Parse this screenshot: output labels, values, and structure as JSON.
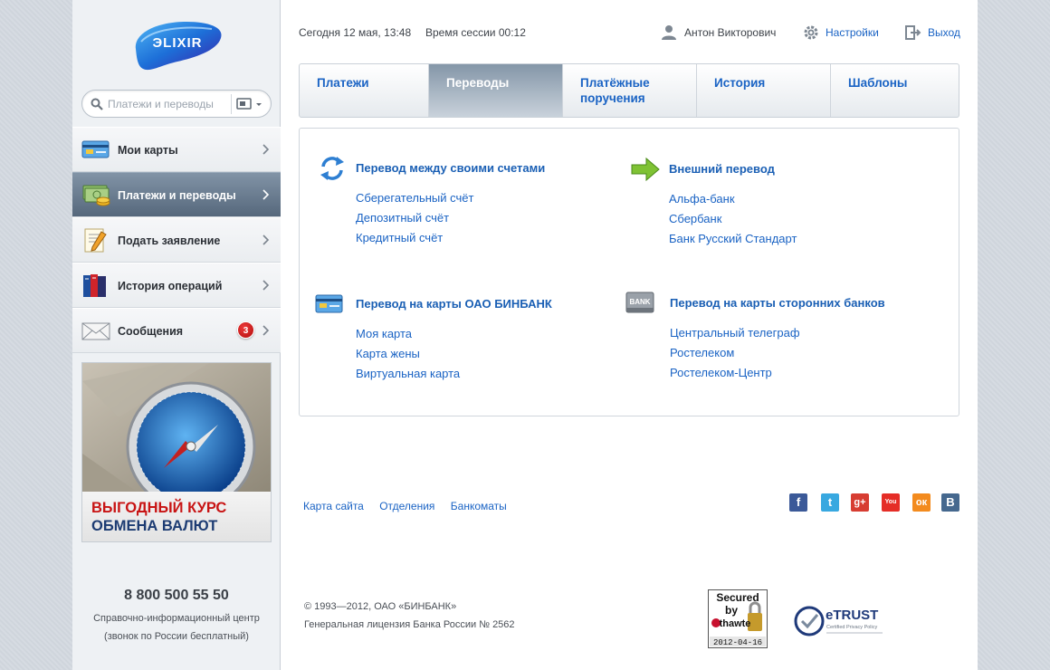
{
  "sidebar": {
    "logo_text": "ЭLIXIR",
    "search": {
      "placeholder": "Платежи и переводы"
    },
    "menu": [
      {
        "label": "Мои карты",
        "icon": "cards-icon",
        "active": false
      },
      {
        "label": "Платежи и переводы",
        "icon": "money-icon",
        "active": true
      },
      {
        "label": "Подать заявление",
        "icon": "application-icon",
        "active": false
      },
      {
        "label": "История операций",
        "icon": "books-icon",
        "active": false
      },
      {
        "label": "Сообщения",
        "icon": "envelope-icon",
        "active": false,
        "badge": "3"
      }
    ],
    "promo": {
      "line1": "ВЫГОДНЫЙ КУРС",
      "line2": "ОБМЕНА ВАЛЮТ"
    },
    "phone": "8 800 500 55 50",
    "phone_note_1": "Справочно-информационный центр",
    "phone_note_2": "(звонок по России бесплатный)"
  },
  "topbar": {
    "date": "Сегодня 12 мая, 13:48",
    "session": "Время сессии 00:12",
    "user": "Антон Викторович",
    "settings": "Настройки",
    "logout": "Выход"
  },
  "tabs": [
    {
      "label": "Платежи",
      "active": false
    },
    {
      "label": "Переводы",
      "active": true
    },
    {
      "label": "Платёжные поручения",
      "active": false
    },
    {
      "label": "История",
      "active": false
    },
    {
      "label": "Шаблоны",
      "active": false
    }
  ],
  "groups": {
    "own_accounts": {
      "title": "Перевод между своими счетами",
      "links": [
        "Сберегательный счёт",
        "Депозитный счёт",
        "Кредитный счёт"
      ]
    },
    "external": {
      "title": "Внешний перевод",
      "links": [
        "Альфа-банк",
        "Сбербанк",
        "Банк Русский Стандарт"
      ]
    },
    "binbank_cards": {
      "title": "Перевод на карты ОАО БИНБАНК",
      "links": [
        "Моя карта",
        "Карта жены",
        "Виртуальная карта"
      ]
    },
    "other_banks": {
      "title": "Перевод на карты сторонних банков",
      "icon_text": "BANK",
      "links": [
        "Центральный телеграф",
        "Ростелеком",
        "Ростелеком-Центр"
      ]
    }
  },
  "footer": {
    "links": [
      "Карта сайта",
      "Отделения",
      "Банкоматы"
    ],
    "socials": [
      {
        "name": "facebook-icon",
        "glyph": "f",
        "color": "#3b5998"
      },
      {
        "name": "twitter-icon",
        "glyph": "t",
        "color": "#38a8e0"
      },
      {
        "name": "google-plus-icon",
        "glyph": "g+",
        "color": "#d73d32"
      },
      {
        "name": "youtube-icon",
        "glyph": "You",
        "color": "#e52d27"
      },
      {
        "name": "odnoklassniki-icon",
        "glyph": "ок",
        "color": "#f38b1e"
      },
      {
        "name": "vkontakte-icon",
        "glyph": "В",
        "color": "#45688e"
      }
    ],
    "copyright_1": "© 1993—2012, ОАО «БИНБАНК»",
    "copyright_2": "Генеральная лицензия Банка России № 2562",
    "thawte": {
      "line1": "Secured",
      "line2": "by",
      "line3": "thawte",
      "date": "2012-04-16"
    },
    "etrust": {
      "title": "eTRUST",
      "subtitle": "Certified Privacy Policy"
    }
  }
}
